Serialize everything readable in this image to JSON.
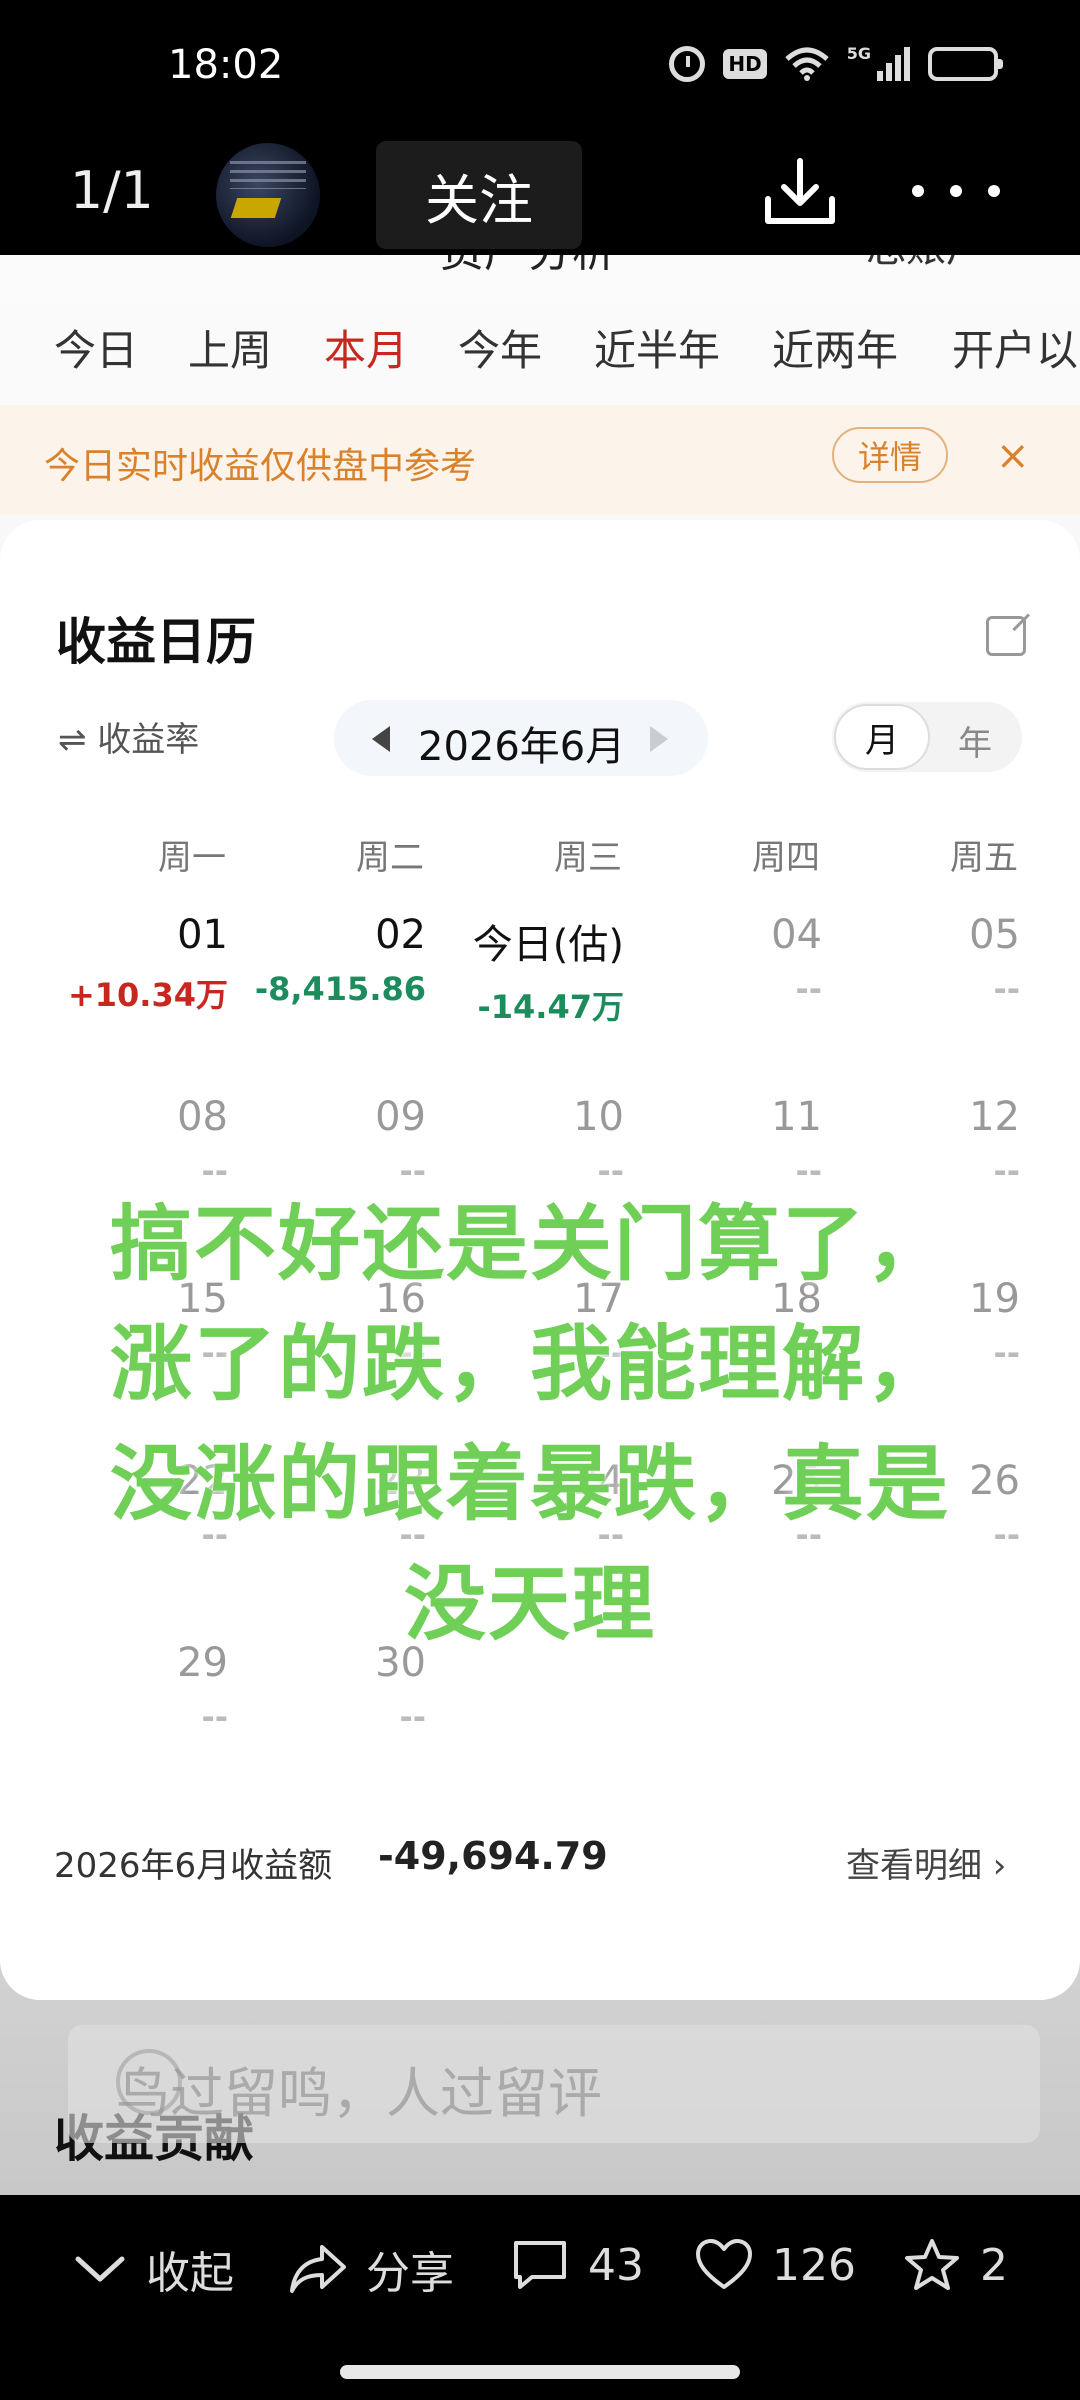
{
  "status_bar": {
    "time": "18:02",
    "network": "5G"
  },
  "viewer": {
    "page_counter": "1/1",
    "follow_label": "关注"
  },
  "app": {
    "header_partial": {
      "title": "资产分析",
      "right": "总账户"
    },
    "period_tabs": [
      "今日",
      "上周",
      "本月",
      "今年",
      "近半年",
      "近两年",
      "开户以"
    ],
    "active_period": "本月",
    "notice": {
      "text": "今日实时收益仅供盘中参考",
      "detail_label": "详情",
      "close": "×"
    },
    "calendar": {
      "title": "收益日历",
      "rate_toggle": "⇌ 收益率",
      "month_label": "2026年6月",
      "view_month": "月",
      "view_year": "年",
      "weekdays": [
        "周一",
        "周二",
        "周三",
        "周四",
        "周五"
      ],
      "days": [
        {
          "num": "01",
          "val": "+10.34万"
        },
        {
          "num": "02",
          "val": "-8,415.86"
        },
        {
          "num": "今日(估)",
          "val": "-14.47万"
        },
        {
          "num": "04",
          "val": "--"
        },
        {
          "num": "05",
          "val": "--"
        },
        {
          "num": "08",
          "val": "--"
        },
        {
          "num": "09",
          "val": "--"
        },
        {
          "num": "10",
          "val": "--"
        },
        {
          "num": "11",
          "val": "--"
        },
        {
          "num": "12",
          "val": "--"
        },
        {
          "num": "15",
          "val": "--"
        },
        {
          "num": "16",
          "val": "--"
        },
        {
          "num": "17",
          "val": "--"
        },
        {
          "num": "18",
          "val": "--"
        },
        {
          "num": "19",
          "val": "--"
        },
        {
          "num": "22",
          "val": "--"
        },
        {
          "num": "23",
          "val": "--"
        },
        {
          "num": "24",
          "val": "--"
        },
        {
          "num": "25",
          "val": "--"
        },
        {
          "num": "26",
          "val": "--"
        },
        {
          "num": "29",
          "val": "--"
        },
        {
          "num": "30",
          "val": "--"
        }
      ],
      "summary_label": "2026年6月收益额",
      "summary_value": "-49,694.79",
      "detail_link": "查看明细 ›"
    },
    "section_title": "收益贡献"
  },
  "overlay_caption": "搞不好还是关门算了，涨了的跌，我能理解，没涨的跟着暴跌，真是没天理",
  "comment": {
    "placeholder": "鸟过留鸣，人过留评"
  },
  "actions": {
    "collapse": "收起",
    "share": "分享",
    "comments": "43",
    "likes": "126",
    "favorites": "2"
  },
  "colors": {
    "accent_red": "#c8271f",
    "down_green": "#1c8c5c",
    "notice_orange": "#d9822b",
    "caption_green": "#6fcf56"
  }
}
